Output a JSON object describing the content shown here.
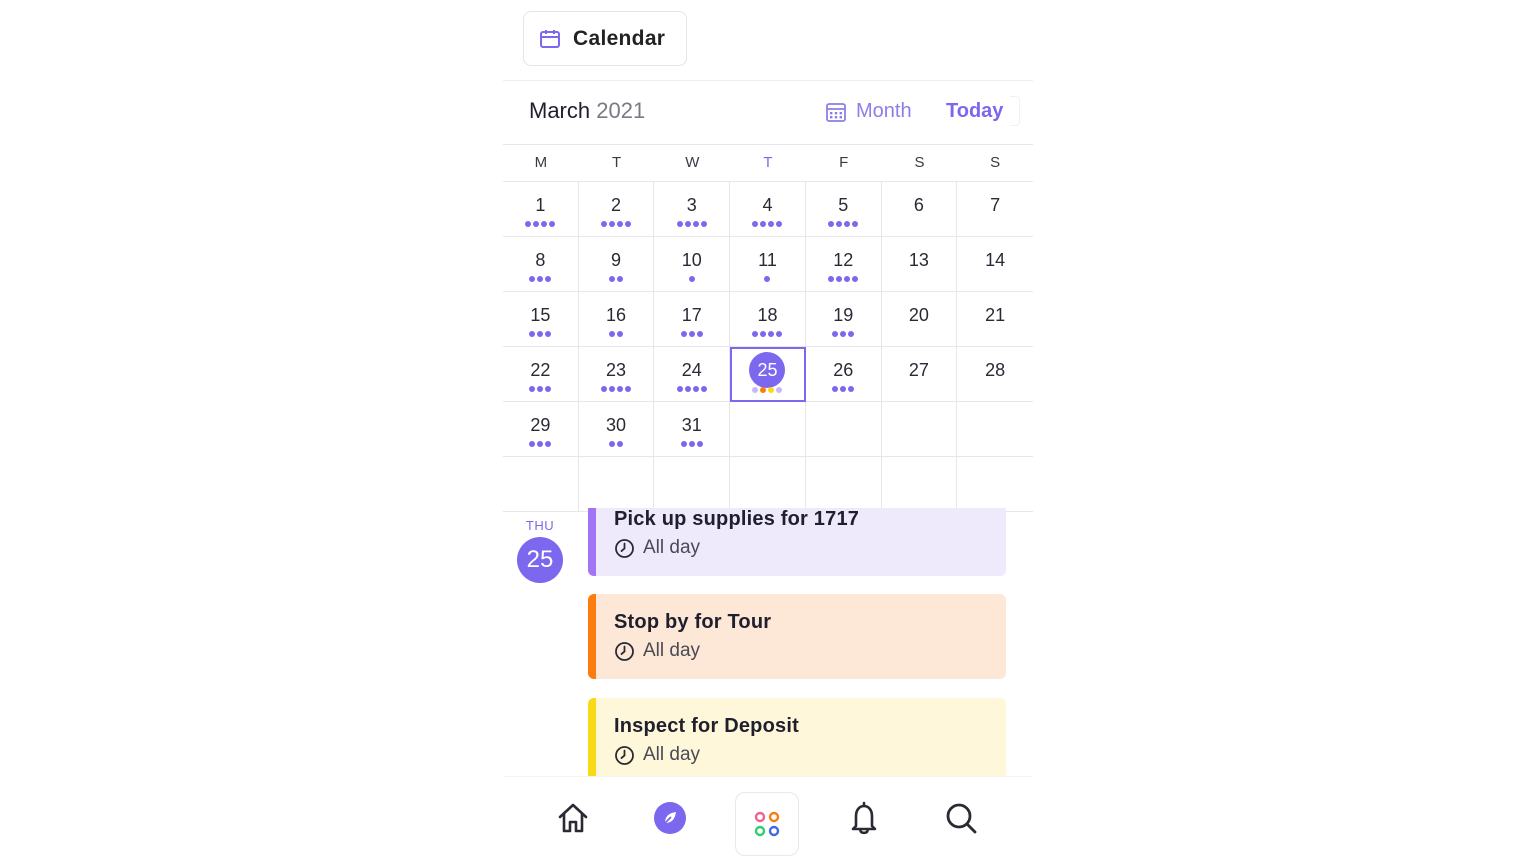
{
  "header": {
    "chip_label": "Calendar"
  },
  "calendar": {
    "month": "March",
    "year": "2021",
    "view_label": "Month",
    "today_label": "Today",
    "weekdays": [
      "M",
      "T",
      "W",
      "T",
      "F",
      "S",
      "S"
    ],
    "today_weekday_index": 3,
    "selected_day": "25",
    "days": [
      {
        "n": "1",
        "dots": 4
      },
      {
        "n": "2",
        "dots": 4
      },
      {
        "n": "3",
        "dots": 4
      },
      {
        "n": "4",
        "dots": 4
      },
      {
        "n": "5",
        "dots": 4
      },
      {
        "n": "6",
        "dots": 0
      },
      {
        "n": "7",
        "dots": 0
      },
      {
        "n": "8",
        "dots": 3
      },
      {
        "n": "9",
        "dots": 2
      },
      {
        "n": "10",
        "dots": 1
      },
      {
        "n": "11",
        "dots": 1
      },
      {
        "n": "12",
        "dots": 4
      },
      {
        "n": "13",
        "dots": 0
      },
      {
        "n": "14",
        "dots": 0
      },
      {
        "n": "15",
        "dots": 3
      },
      {
        "n": "16",
        "dots": 2
      },
      {
        "n": "17",
        "dots": 3
      },
      {
        "n": "18",
        "dots": 4
      },
      {
        "n": "19",
        "dots": 3
      },
      {
        "n": "20",
        "dots": 0
      },
      {
        "n": "21",
        "dots": 0
      },
      {
        "n": "22",
        "dots": 3
      },
      {
        "n": "23",
        "dots": 4
      },
      {
        "n": "24",
        "dots": 4
      },
      {
        "n": "25",
        "dots": 4,
        "dot_colors": [
          "#c9b8f7",
          "#fb7d10",
          "#f8d915",
          "#c9b8f7"
        ]
      },
      {
        "n": "26",
        "dots": 3
      },
      {
        "n": "27",
        "dots": 0
      },
      {
        "n": "28",
        "dots": 0
      },
      {
        "n": "29",
        "dots": 3
      },
      {
        "n": "30",
        "dots": 2
      },
      {
        "n": "31",
        "dots": 3
      },
      {
        "n": "",
        "dots": 0
      },
      {
        "n": "",
        "dots": 0
      },
      {
        "n": "",
        "dots": 0
      },
      {
        "n": "",
        "dots": 0
      },
      {
        "n": "",
        "dots": 0
      },
      {
        "n": "",
        "dots": 0
      },
      {
        "n": "",
        "dots": 0
      },
      {
        "n": "",
        "dots": 0
      },
      {
        "n": "",
        "dots": 0
      },
      {
        "n": "",
        "dots": 0
      },
      {
        "n": "",
        "dots": 0
      }
    ]
  },
  "agenda": {
    "day_of_week": "THU",
    "day_number": "25",
    "events": [
      {
        "title": "Pick up supplies for 1717",
        "time": "All day",
        "color": "#a175f5"
      },
      {
        "title": "Stop by for Tour",
        "time": "All day",
        "color": "#fb7d10"
      },
      {
        "title": "Inspect for Deposit",
        "time": "All day",
        "color": "#f8d915"
      }
    ]
  },
  "nav": [
    "home-icon",
    "explore-icon",
    "apps-icon",
    "bell-icon",
    "search-icon"
  ],
  "colors": {
    "accent": "#7b68ee"
  }
}
